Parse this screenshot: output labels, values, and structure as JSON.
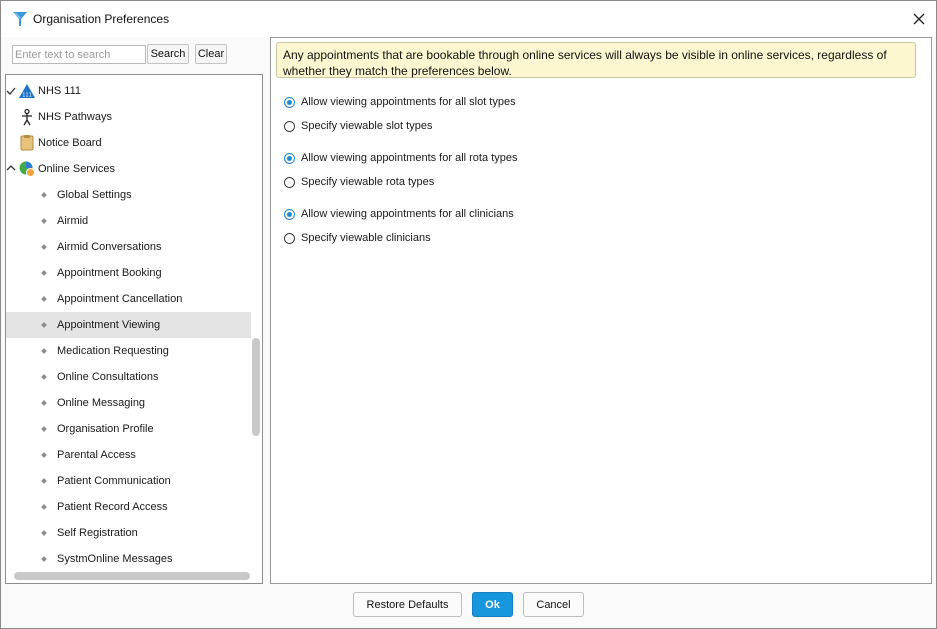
{
  "window": {
    "title": "Organisation Preferences"
  },
  "search": {
    "placeholder": "Enter text to search",
    "value": "",
    "search_label": "Search",
    "clear_label": "Clear"
  },
  "tree": {
    "top_items": [
      {
        "label": "NHS 111",
        "icon": "nhs111-icon",
        "expander": "check"
      },
      {
        "label": "NHS Pathways",
        "icon": "person-pathways-icon"
      },
      {
        "label": "Notice Board",
        "icon": "notice-board-icon"
      },
      {
        "label": "Online Services",
        "icon": "online-services-globe-icon",
        "expander": "expanded"
      }
    ],
    "children": [
      {
        "label": "Global Settings"
      },
      {
        "label": "Airmid"
      },
      {
        "label": "Airmid Conversations"
      },
      {
        "label": "Appointment Booking"
      },
      {
        "label": "Appointment Cancellation"
      },
      {
        "label": "Appointment Viewing",
        "selected": true
      },
      {
        "label": "Medication Requesting"
      },
      {
        "label": "Online Consultations"
      },
      {
        "label": "Online Messaging"
      },
      {
        "label": "Organisation Profile"
      },
      {
        "label": "Parental Access"
      },
      {
        "label": "Patient Communication"
      },
      {
        "label": "Patient Record Access"
      },
      {
        "label": "Self Registration"
      },
      {
        "label": "SystmOnline Messages"
      }
    ]
  },
  "content": {
    "info_text": "Any appointments that are bookable through online services will always be visible in online services, regardless of whether they match the preferences below.",
    "groups": [
      {
        "options": [
          {
            "label": "Allow viewing appointments for all slot types",
            "checked": true
          },
          {
            "label": "Specify viewable slot types",
            "checked": false
          }
        ]
      },
      {
        "options": [
          {
            "label": "Allow viewing appointments for all rota types",
            "checked": true
          },
          {
            "label": "Specify viewable rota types",
            "checked": false
          }
        ]
      },
      {
        "options": [
          {
            "label": "Allow viewing appointments for all clinicians",
            "checked": true
          },
          {
            "label": "Specify viewable clinicians",
            "checked": false
          }
        ]
      }
    ]
  },
  "footer": {
    "restore_label": "Restore Defaults",
    "ok_label": "Ok",
    "cancel_label": "Cancel"
  },
  "colors": {
    "accent": "#1896dd",
    "banner_bg": "#fdf7d1",
    "selected_row": "#e4e4e4"
  }
}
